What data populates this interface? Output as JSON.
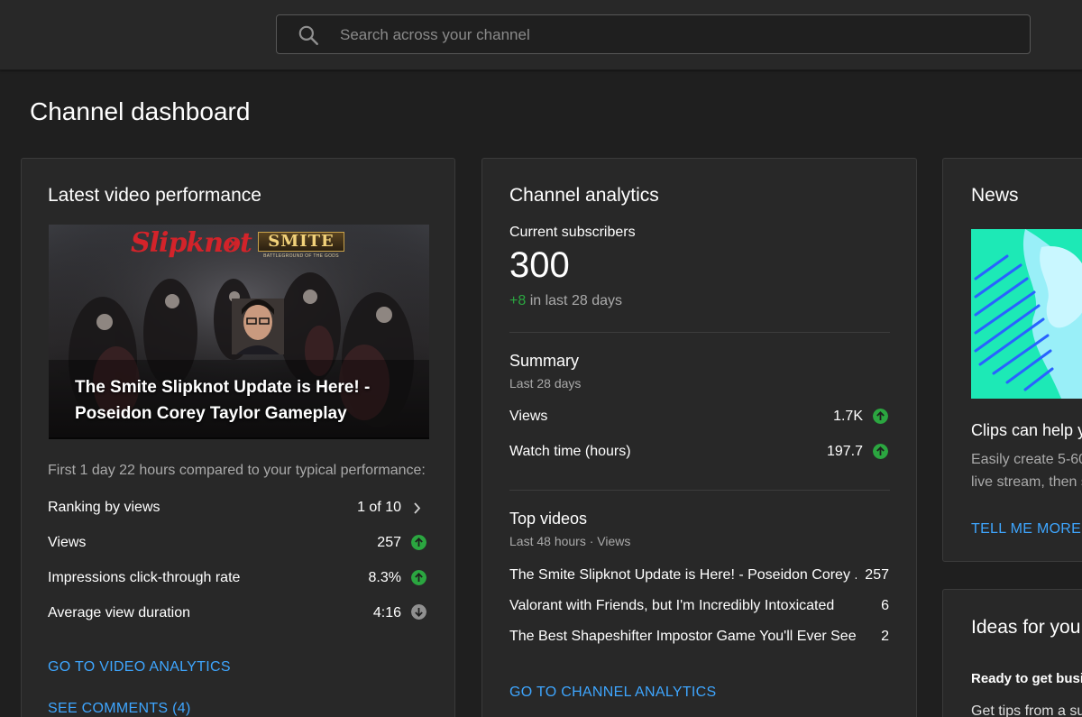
{
  "search": {
    "placeholder": "Search across your channel"
  },
  "page_title": "Channel dashboard",
  "latest_video": {
    "title": "Latest video performance",
    "thumbnail": {
      "title_line1": "The Smite Slipknot Update is Here! -",
      "title_line2": "Poseidon Corey Taylor Gameplay",
      "logo_left": "Slipknot",
      "logo_x": "×",
      "logo_right": "SMITE",
      "logo_right_sub": "BATTLEGROUND OF THE GODS"
    },
    "comparison_note": "First 1 day 22 hours compared to your typical performance:",
    "metrics": [
      {
        "label": "Ranking by views",
        "value": "1 of 10",
        "status": "chevron-right-icon"
      },
      {
        "label": "Views",
        "value": "257",
        "status": "arrow-up-icon"
      },
      {
        "label": "Impressions click-through rate",
        "value": "8.3%",
        "status": "arrow-up-icon"
      },
      {
        "label": "Average view duration",
        "value": "4:16",
        "status": "arrow-down-icon"
      }
    ],
    "video_analytics_link": "GO TO VIDEO ANALYTICS",
    "comments_link": "SEE COMMENTS (4)"
  },
  "channel_analytics": {
    "title": "Channel analytics",
    "subscribers_label": "Current subscribers",
    "subscribers_count": "300",
    "subscribers_change": "+8",
    "subscribers_change_suffix": "in last 28 days",
    "summary": {
      "title": "Summary",
      "subtitle": "Last 28 days",
      "rows": [
        {
          "label": "Views",
          "value": "1.7K",
          "status": "arrow-up-icon"
        },
        {
          "label": "Watch time (hours)",
          "value": "197.7",
          "status": "arrow-up-icon"
        }
      ]
    },
    "top_videos": {
      "title": "Top videos",
      "subtitle": "Last 48 hours · Views",
      "rows": [
        {
          "title": "The Smite Slipknot Update is Here! - Poseidon Corey ...",
          "views": "257"
        },
        {
          "title": "Valorant with Friends, but I'm Incredibly Intoxicated",
          "views": "6"
        },
        {
          "title": "The Best Shapeshifter Impostor Game You'll Ever See",
          "views": "2"
        }
      ]
    },
    "link": "GO TO CHANNEL ANALYTICS"
  },
  "news": {
    "title": "News",
    "headline": "Clips can help y",
    "body_line1": "Easily create 5-60",
    "body_line2": "live stream, then s",
    "link": "TELL ME MORE"
  },
  "ideas": {
    "title": "Ideas for you",
    "subtitle": "Ready to get busi",
    "body": "Get tips from a su"
  },
  "colors": {
    "background": "#1f1f1f",
    "card": "#282828",
    "link": "#3ea6ff",
    "positive": "#2ba640",
    "neutral_icon": "#909090"
  }
}
